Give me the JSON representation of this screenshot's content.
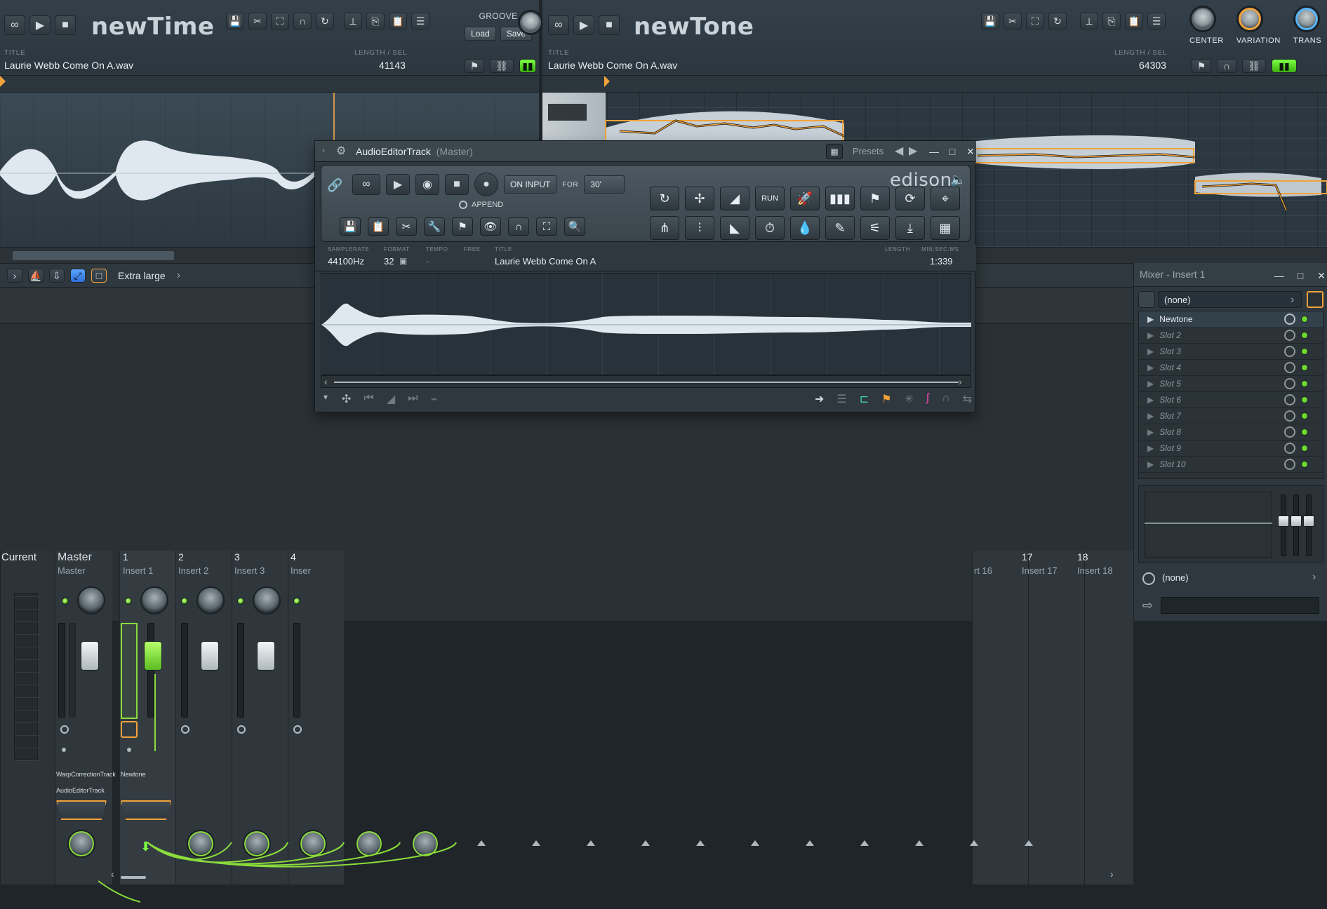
{
  "left_plugin": {
    "name": "newTime",
    "title_label": "TITLE",
    "title_value": "Laurie Webb Come On A.wav",
    "length_label": "LENGTH / SEL",
    "length_value": "41143",
    "groove_label": "GROOVE",
    "groove_buttons": [
      "Load",
      "Save"
    ]
  },
  "right_plugin": {
    "name": "newTone",
    "title_label": "TITLE",
    "title_value": "Laurie Webb Come On A.wav",
    "length_label": "LENGTH / SEL",
    "length_value": "64303",
    "knobs": [
      "CENTER",
      "VARIATION",
      "TRANS"
    ]
  },
  "mixer_toolbar": {
    "size_label": "Extra large"
  },
  "mixer_tracks": [
    {
      "num": "Current",
      "name": ""
    },
    {
      "num": "Master",
      "name": "Master"
    },
    {
      "num": "1",
      "name": "Insert 1"
    },
    {
      "num": "2",
      "name": "Insert 2"
    },
    {
      "num": "3",
      "name": "Insert 3"
    },
    {
      "num": "4",
      "name": "Inser"
    },
    {
      "num": "17",
      "name": "Insert 17"
    },
    {
      "num": "18",
      "name": "Insert 18"
    },
    {
      "num": "",
      "name": "rt 16"
    }
  ],
  "mixer_fx_labels": {
    "master_1": "WarpCorrectionTrack",
    "master_2": "AudioEditorTrack",
    "insert1_1": "Newtone"
  },
  "edison": {
    "window_title": "AudioEditorTrack",
    "window_sub": "(Master)",
    "presets_label": "Presets",
    "brand": "edison",
    "on_input_label": "ON INPUT",
    "for_label": "FOR",
    "for_value": "30'",
    "append_label": "APPEND",
    "tool_run_label": "RUN",
    "info": {
      "samplerate_label": "SAMPLERATE",
      "samplerate_value": "44100Hz",
      "format_label": "FORMAT",
      "format_value": "32",
      "tempo_label": "TEMPO",
      "tempo_value": "-",
      "free_label": "FREE",
      "title_label": "TITLE",
      "title_value": "Laurie Webb Come On A",
      "length_label": "LENGTH",
      "minsec_label": "MIN:SEC:MS",
      "length_value": "1:339"
    }
  },
  "mixer_side": {
    "title": "Mixer - Insert 1",
    "preset_value": "(none)",
    "slots": [
      {
        "name": "Newtone",
        "active": true
      },
      {
        "name": "Slot 2",
        "active": false
      },
      {
        "name": "Slot 3",
        "active": false
      },
      {
        "name": "Slot 4",
        "active": false
      },
      {
        "name": "Slot 5",
        "active": false
      },
      {
        "name": "Slot 6",
        "active": false
      },
      {
        "name": "Slot 7",
        "active": false
      },
      {
        "name": "Slot 8",
        "active": false
      },
      {
        "name": "Slot 9",
        "active": false
      },
      {
        "name": "Slot 10",
        "active": false
      }
    ],
    "bottom_preset": "(none)"
  },
  "icons": {
    "loop": "loop-icon",
    "play": "play-icon",
    "stop": "stop-icon",
    "save": "save-icon",
    "cut": "cut-icon",
    "select": "select-icon",
    "magnet": "magnet-icon",
    "reset": "reset-icon",
    "close": "close-icon",
    "minimize": "minimize-icon",
    "maximize": "maximize-icon",
    "gear": "gear-icon",
    "grid": "grid-icon"
  },
  "colors": {
    "accent": "#f2a23a",
    "green": "#73d23a",
    "wave": "#dfe8ee"
  }
}
